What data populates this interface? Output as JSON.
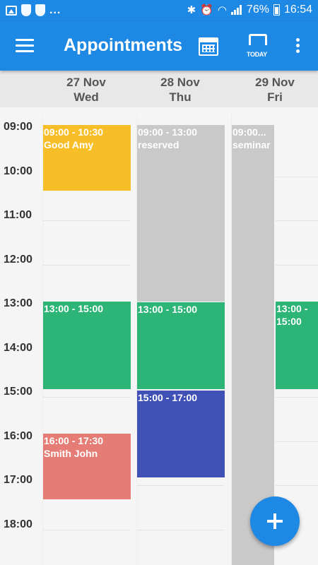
{
  "status_bar": {
    "left_dots": "...",
    "battery": "76%",
    "time": "16:54",
    "icons": [
      "image-icon",
      "shield-icon",
      "shield-icon",
      "bluetooth-icon",
      "alarm-icon",
      "wifi-icon",
      "signal-icon",
      "battery-icon"
    ]
  },
  "app_bar": {
    "title": "Appointments",
    "today_label": "TODAY",
    "icons": [
      "menu-icon",
      "calendar-icon",
      "today-icon",
      "more-vert-icon"
    ],
    "color": "#1E88E5"
  },
  "days": [
    {
      "date": "27 Nov",
      "weekday": "Wed"
    },
    {
      "date": "28 Nov",
      "weekday": "Thu"
    },
    {
      "date": "29 Nov",
      "weekday": "Fri"
    }
  ],
  "hours": [
    "09:00",
    "10:00",
    "11:00",
    "12:00",
    "13:00",
    "14:00",
    "15:00",
    "16:00",
    "17:00",
    "18:00"
  ],
  "events": {
    "wed": [
      {
        "time": "09:00 - 10:30",
        "title": "Good Amy",
        "color": "#F7BE28"
      },
      {
        "time": "13:00 - 15:00",
        "title": "",
        "color": "#2DB577"
      },
      {
        "time": "16:00 - 17:30",
        "title": "Smith John",
        "color": "#E57C75"
      }
    ],
    "thu": [
      {
        "time": "09:00 - 13:00",
        "title": "reserved",
        "color": "#C9C9C9"
      },
      {
        "time": "13:00 - 15:00",
        "title": "",
        "color": "#2DB577"
      },
      {
        "time": "15:00 - 17:00",
        "title": "",
        "color": "#3F51B5"
      }
    ],
    "fri": [
      {
        "time": "09:00...",
        "title": "seminar",
        "color": "#C9C9C9"
      },
      {
        "time_line1": "13:00 -",
        "time_line2": "15:00",
        "color": "#2DB577"
      }
    ]
  },
  "fab": {
    "icon": "plus-icon",
    "color": "#1E88E5"
  }
}
